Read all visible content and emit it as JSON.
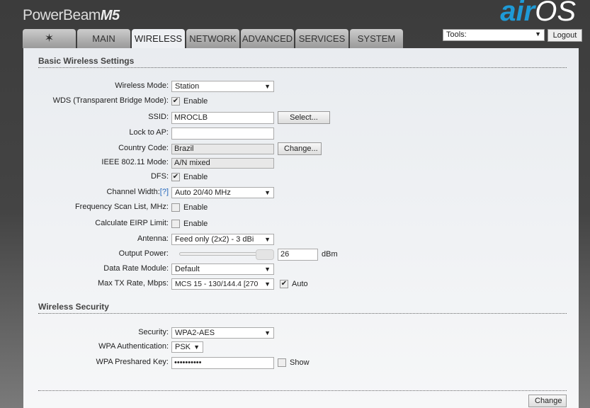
{
  "header": {
    "product": "PowerBeam",
    "model": "M5",
    "logo_air": "air",
    "logo_os": "OS"
  },
  "tabs": [
    {
      "label": "",
      "icon": "ubiquiti-logo-icon"
    },
    {
      "label": "MAIN"
    },
    {
      "label": "WIRELESS"
    },
    {
      "label": "NETWORK"
    },
    {
      "label": "ADVANCED"
    },
    {
      "label": "SERVICES"
    },
    {
      "label": "SYSTEM"
    }
  ],
  "tools": {
    "value": "Tools:",
    "logout": "Logout"
  },
  "basic": {
    "title": "Basic Wireless Settings",
    "wireless_mode": {
      "label": "Wireless Mode:",
      "value": "Station"
    },
    "wds": {
      "label": "WDS (Transparent Bridge Mode):",
      "checked": true,
      "text": "Enable"
    },
    "ssid": {
      "label": "SSID:",
      "value": "MROCLB",
      "button": "Select..."
    },
    "lock_ap": {
      "label": "Lock to AP:",
      "value": ""
    },
    "country": {
      "label": "Country Code:",
      "value": "Brazil",
      "button": "Change..."
    },
    "ieee": {
      "label": "IEEE 802.11 Mode:",
      "value": "A/N mixed"
    },
    "dfs": {
      "label": "DFS:",
      "checked": true,
      "text": "Enable"
    },
    "channel_width": {
      "label": "Channel Width:",
      "help": "[?]",
      "value": "Auto 20/40 MHz"
    },
    "freq_scan": {
      "label": "Frequency Scan List, MHz:",
      "checked": false,
      "text": "Enable"
    },
    "eirp": {
      "label": "Calculate EIRP Limit:",
      "checked": false,
      "text": "Enable"
    },
    "antenna": {
      "label": "Antenna:",
      "value": "Feed only (2x2) - 3 dBi"
    },
    "output_power": {
      "label": "Output Power:",
      "value": "26",
      "unit": "dBm",
      "slider_fraction": 1.0
    },
    "data_rate": {
      "label": "Data Rate Module:",
      "value": "Default"
    },
    "max_tx": {
      "label": "Max TX Rate, Mbps:",
      "value": "MCS 15 - 130/144.4 [270",
      "auto_checked": true,
      "auto": "Auto"
    }
  },
  "security": {
    "title": "Wireless Security",
    "security": {
      "label": "Security:",
      "value": "WPA2-AES"
    },
    "wpa_auth": {
      "label": "WPA Authentication:",
      "value": "PSK"
    },
    "psk": {
      "label": "WPA Preshared Key:",
      "value": "••••••••••",
      "show": "Show",
      "show_checked": false
    }
  },
  "footer": {
    "change": "Change"
  }
}
